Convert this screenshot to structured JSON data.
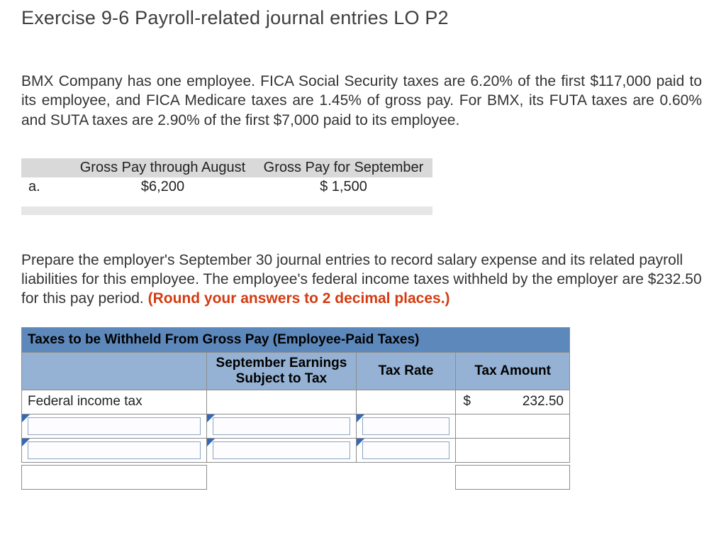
{
  "title": "Exercise 9-6 Payroll-related journal entries LO P2",
  "intro": "BMX Company has one employee. FICA Social Security taxes are 6.20% of the first $117,000 paid to its employee, and FICA Medicare taxes are 1.45% of gross pay. For BMX, its FUTA taxes are 0.60% and SUTA taxes are 2.90% of the first $7,000 paid to its employee.",
  "gross": {
    "head_aug": "Gross Pay through August",
    "head_sep": "Gross Pay for September",
    "row_label": "a.",
    "val_aug": "$6,200",
    "val_sep": "$ 1,500"
  },
  "instructions": {
    "text": "Prepare the employer's September 30 journal entries to record salary expense and its related payroll liabilities for this employee. The employee's federal income taxes withheld by the employer are $232.50 for this pay period. ",
    "hint": "(Round your answers to 2 decimal places.)"
  },
  "worksheet": {
    "title": "Taxes to be Withheld From Gross Pay (Employee-Paid Taxes)",
    "col_earn": "September Earnings Subject to Tax",
    "col_rate": "Tax Rate",
    "col_amt": "Tax Amount",
    "rows": [
      {
        "name": "Federal income tax",
        "currency": "$",
        "amount": "232.50"
      }
    ]
  }
}
